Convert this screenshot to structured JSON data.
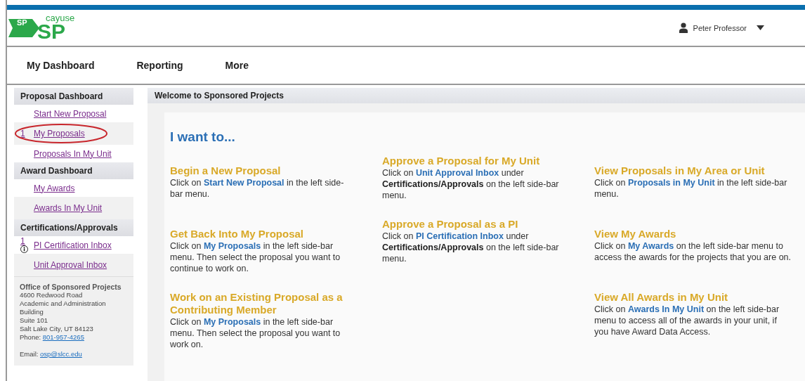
{
  "header": {
    "logo": {
      "badge": "SP",
      "small": "cayuse",
      "big": "SP"
    },
    "user": {
      "name": "Peter Professor"
    }
  },
  "nav": [
    {
      "label": "My Dashboard"
    },
    {
      "label": "Reporting"
    },
    {
      "label": "More"
    }
  ],
  "sidebar": {
    "sections": [
      {
        "title": "Proposal Dashboard",
        "items": [
          {
            "label": "Start New Proposal"
          },
          {
            "label": "My Proposals",
            "count": "1",
            "circled": true
          },
          {
            "label": "Proposals In My Unit"
          }
        ]
      },
      {
        "title": "Award Dashboard",
        "items": [
          {
            "label": "My Awards"
          },
          {
            "label": "Awards In My Unit"
          }
        ]
      },
      {
        "title": "Certifications/Approvals",
        "items": [
          {
            "label": "PI Certification Inbox",
            "count": "1",
            "info": true
          },
          {
            "label": "Unit Approval Inbox"
          }
        ]
      }
    ],
    "contact": {
      "title": "Office of Sponsored Projects",
      "lines": [
        "4600 Redwood Road",
        "Academic and Administration Building",
        "Suite 101",
        "Salt Lake City, UT 84123"
      ],
      "phone_label": "Phone:",
      "phone": "801-957-4265",
      "email_label": "Email:",
      "email": "osp@slcc.edu"
    }
  },
  "panel": {
    "title": "Welcome to Sponsored Projects",
    "heading": "I want to...",
    "columns": [
      [
        {
          "title": "Begin a New Proposal",
          "body": [
            {
              "kind": "plain",
              "text": "Click on "
            },
            {
              "kind": "link",
              "text": "Start New Proposal"
            },
            {
              "kind": "plain",
              "text": " in the left side-bar menu."
            }
          ]
        },
        {
          "title": "Get Back Into My Proposal",
          "body": [
            {
              "kind": "plain",
              "text": "Click on "
            },
            {
              "kind": "link",
              "text": "My Proposals"
            },
            {
              "kind": "plain",
              "text": " in the left side-bar menu. Then select the proposal you want to continue to work on."
            }
          ]
        },
        {
          "title": "Work on an Existing Proposal as a Contributing Member",
          "body": [
            {
              "kind": "plain",
              "text": "Click on "
            },
            {
              "kind": "link",
              "text": "My Proposals"
            },
            {
              "kind": "plain",
              "text": " in the left side-bar menu. Then select the proposal you want to work on."
            }
          ]
        }
      ],
      [
        {
          "title": "Approve a Proposal for My Unit",
          "body": [
            {
              "kind": "plain",
              "text": "Click on "
            },
            {
              "kind": "link",
              "text": "Unit Approval Inbox"
            },
            {
              "kind": "plain",
              "text": " under "
            },
            {
              "kind": "bold",
              "text": "Certifications/Approvals"
            },
            {
              "kind": "plain",
              "text": " on the left side-bar menu."
            }
          ]
        },
        {
          "title": "Approve a Proposal as a PI",
          "body": [
            {
              "kind": "plain",
              "text": "Click on "
            },
            {
              "kind": "link",
              "text": "PI Certification Inbox"
            },
            {
              "kind": "plain",
              "text": " under "
            },
            {
              "kind": "bold",
              "text": "Certifications/Approvals"
            },
            {
              "kind": "plain",
              "text": " on the left side-bar menu."
            }
          ]
        }
      ],
      [
        {
          "title": "View Proposals in My Area or Unit",
          "body": [
            {
              "kind": "plain",
              "text": "Click on "
            },
            {
              "kind": "link",
              "text": "Proposals in My Unit"
            },
            {
              "kind": "plain",
              "text": " in the left side-bar menu."
            }
          ]
        },
        {
          "title": "View My Awards",
          "body": [
            {
              "kind": "plain",
              "text": "Click on "
            },
            {
              "kind": "link",
              "text": "My Awards"
            },
            {
              "kind": "plain",
              "text": " on the left side-bar menu to access the awards for the projects that you are on."
            }
          ]
        },
        {
          "title": "View All Awards in My Unit",
          "body": [
            {
              "kind": "plain",
              "text": "Click on "
            },
            {
              "kind": "link",
              "text": "Awards In My Unit"
            },
            {
              "kind": "plain",
              "text": " on the left side-bar menu to access all of the awards in your unit, if you have Award Data Access."
            }
          ]
        }
      ]
    ]
  }
}
